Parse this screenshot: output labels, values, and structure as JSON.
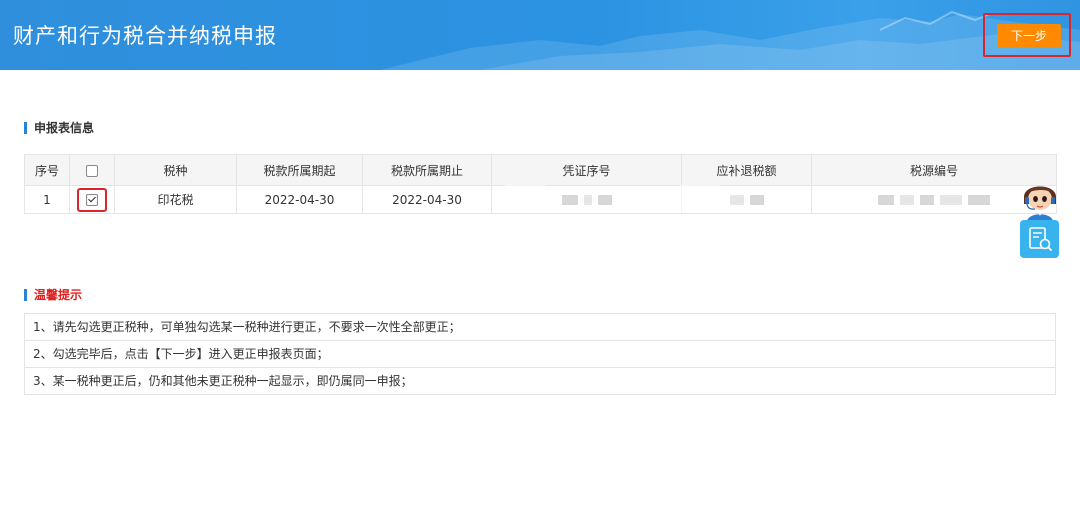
{
  "header": {
    "title": "财产和行为税合并纳税申报",
    "next_button": "下一步"
  },
  "declaration": {
    "section_title": "申报表信息",
    "columns": [
      "序号",
      "",
      "税种",
      "税款所属期起",
      "税款所属期止",
      "凭证序号",
      "应补退税额",
      "税源编号"
    ],
    "header_checkbox_checked": false,
    "rows": [
      {
        "index": "1",
        "checked": true,
        "tax_type": "印花税",
        "period_start": "2022-04-30",
        "period_end": "2022-04-30"
      }
    ]
  },
  "tips": {
    "section_title": "温馨提示",
    "items": [
      "1、请先勾选更正税种，可单独勾选某一税种进行更正，不要求一次性全部更正；",
      "2、勾选完毕后，点击【下一步】进入更正申报表页面；",
      "3、某一税种更正后，仍和其他未更正税种一起显示，即仍属同一申报；"
    ]
  },
  "colors": {
    "header_blue": "#2b93e2",
    "accent_orange": "#ff8a00",
    "highlight_red": "#d9262b",
    "tip_title_red": "#e02020"
  },
  "icons": {
    "assistant": "customer-service-avatar-icon",
    "search": "document-search-icon"
  }
}
